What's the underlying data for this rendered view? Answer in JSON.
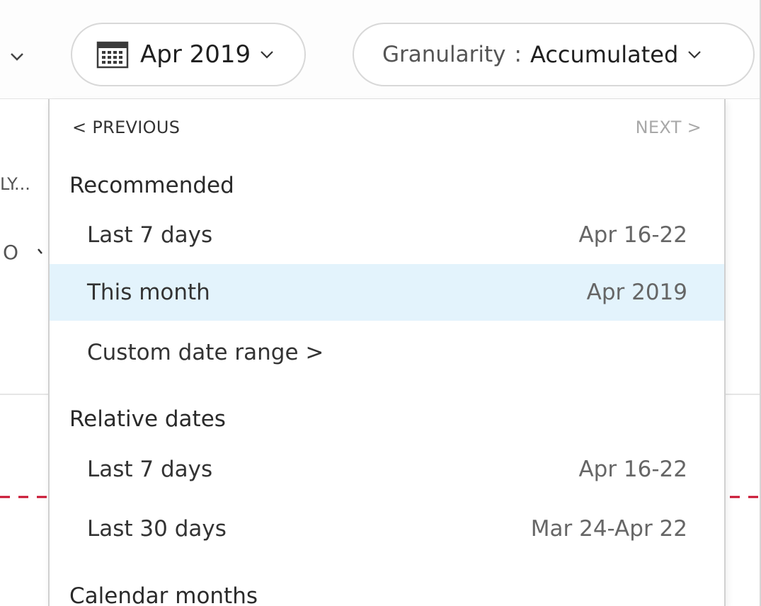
{
  "toolbar": {
    "date_picker": {
      "label": "Apr 2019",
      "icon": "calendar-icon"
    },
    "granularity": {
      "label": "Granularity",
      "separator": ":",
      "value": "Accumulated"
    }
  },
  "background": {
    "fragment_1": "LY...",
    "fragment_2": "O",
    "dashed_line_color": "#c8102e"
  },
  "dropdown": {
    "previous_label": "< PREVIOUS",
    "next_label": "NEXT >",
    "sections": {
      "recommended": {
        "title": "Recommended",
        "items": [
          {
            "label": "Last 7 days",
            "value": "Apr 16-22"
          },
          {
            "label": "This month",
            "value": "Apr 2019",
            "selected": true
          },
          {
            "label": "Custom date range >",
            "value": ""
          }
        ]
      },
      "relative": {
        "title": "Relative dates",
        "items": [
          {
            "label": "Last 7 days",
            "value": "Apr 16-22"
          },
          {
            "label": "Last 30 days",
            "value": "Mar 24-Apr 22"
          }
        ]
      },
      "calendar": {
        "title": "Calendar months"
      }
    }
  },
  "colors": {
    "selected_row_bg": "#e3f3fc",
    "disabled_text": "#a8a8a8"
  }
}
